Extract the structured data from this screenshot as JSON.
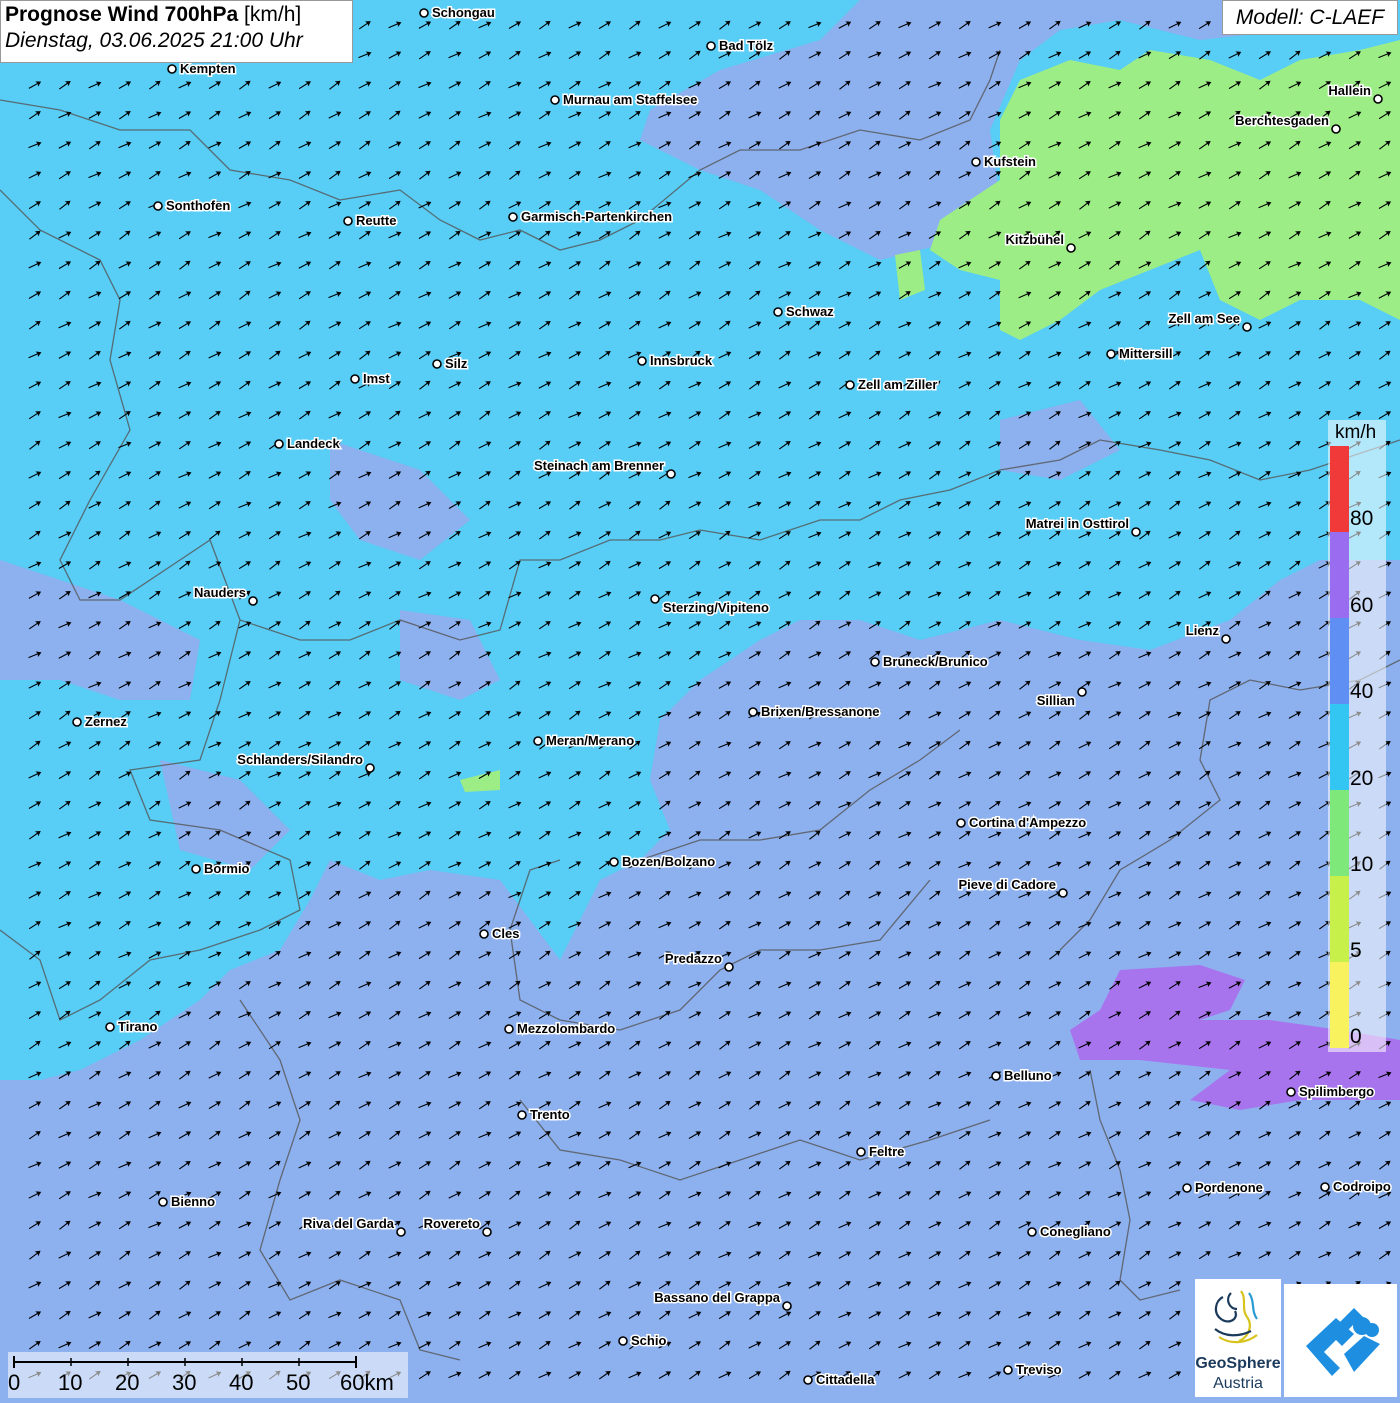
{
  "title": {
    "main": "Prognose Wind 700hPa",
    "unit": "[km/h]",
    "date": "Dienstag, 03.06.2025 21:00 Uhr"
  },
  "model": "Modell: C-LAEF",
  "legend": {
    "unit": "km/h",
    "labels": [
      "80",
      "60",
      "40",
      "20",
      "10",
      "5",
      "0"
    ],
    "colors": [
      "#f03a3a",
      "#9a6cf0",
      "#5f8ff2",
      "#33c6f2",
      "#7fe87a",
      "#c8f04a",
      "#f7f25e"
    ]
  },
  "scale": {
    "labels": [
      "0",
      "10",
      "20",
      "30",
      "40",
      "50",
      "60km"
    ]
  },
  "logos": {
    "geosphere_line1": "GeoSphere",
    "geosphere_line2": "Austria",
    "geosphere_icon": "geosphere-logo-icon",
    "warn_icon": "warning-app-logo-icon"
  },
  "cities": [
    {
      "name": "Schongau"
    },
    {
      "name": "Bad Tölz"
    },
    {
      "name": "Kempten"
    },
    {
      "name": "Murnau am Staffelsee"
    },
    {
      "name": "Hallein"
    },
    {
      "name": "Berchtesgaden"
    },
    {
      "name": "Kufstein"
    },
    {
      "name": "Sonthofen"
    },
    {
      "name": "Reutte"
    },
    {
      "name": "Garmisch-Partenkirchen"
    },
    {
      "name": "Kitzbühel"
    },
    {
      "name": "Schwaz"
    },
    {
      "name": "Zell am See"
    },
    {
      "name": "Mittersill"
    },
    {
      "name": "Innsbruck"
    },
    {
      "name": "Silz"
    },
    {
      "name": "Imst"
    },
    {
      "name": "Zell am Ziller"
    },
    {
      "name": "Landeck"
    },
    {
      "name": "Steinach am Brenner"
    },
    {
      "name": "Matrei in Osttirol"
    },
    {
      "name": "Nauders"
    },
    {
      "name": "Sterzing/Vipiteno"
    },
    {
      "name": "Lienz"
    },
    {
      "name": "Bruneck/Brunico"
    },
    {
      "name": "Sillian"
    },
    {
      "name": "Brixen/Bressanone"
    },
    {
      "name": "Zernez"
    },
    {
      "name": "Meran/Merano"
    },
    {
      "name": "Schlanders/Silandro"
    },
    {
      "name": "Cortina d'Ampezzo"
    },
    {
      "name": "Bozen/Bolzano"
    },
    {
      "name": "Bormio"
    },
    {
      "name": "Pieve di Cadore"
    },
    {
      "name": "Cles"
    },
    {
      "name": "Predazzo"
    },
    {
      "name": "Tirano"
    },
    {
      "name": "Mezzolombardo"
    },
    {
      "name": "Belluno"
    },
    {
      "name": "Spilimbergo"
    },
    {
      "name": "Trento"
    },
    {
      "name": "Feltre"
    },
    {
      "name": "Pordenone"
    },
    {
      "name": "Codroipo"
    },
    {
      "name": "Bienno"
    },
    {
      "name": "Riva del Garda"
    },
    {
      "name": "Rovereto"
    },
    {
      "name": "Conegliano"
    },
    {
      "name": "Bassano del Grappa"
    },
    {
      "name": "Schio"
    },
    {
      "name": "Treviso"
    },
    {
      "name": "Cittadella"
    }
  ]
}
